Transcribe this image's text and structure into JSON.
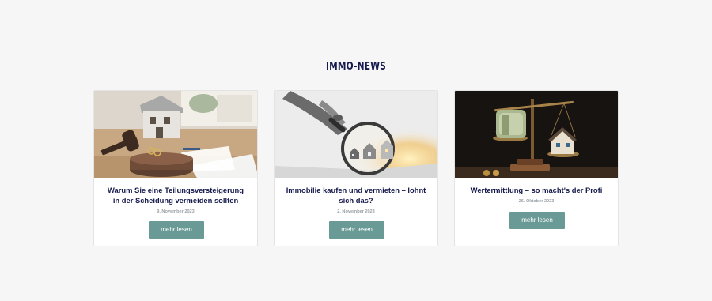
{
  "section": {
    "title": "IMMO-NEWS"
  },
  "colors": {
    "title": "#161a4c",
    "button": "#6a9a95",
    "date": "#9aa0a6",
    "background": "#f6f6f6"
  },
  "cards": [
    {
      "title": "Warum Sie eine Teilungsversteigerung in der Scheidung vermeiden sollten",
      "date": "9. November 2023",
      "button_label": "mehr lesen",
      "image": "house-model-gavel-photo"
    },
    {
      "title": "Immobilie kaufen und vermieten – lohnt sich das?",
      "date": "2. November 2023",
      "button_label": "mehr lesen",
      "image": "magnifying-glass-houses-photo"
    },
    {
      "title": "Wertermittlung – so macht's der Profi",
      "date": "26. Oktober 2023",
      "button_label": "mehr lesen",
      "image": "scale-money-house-photo"
    }
  ]
}
